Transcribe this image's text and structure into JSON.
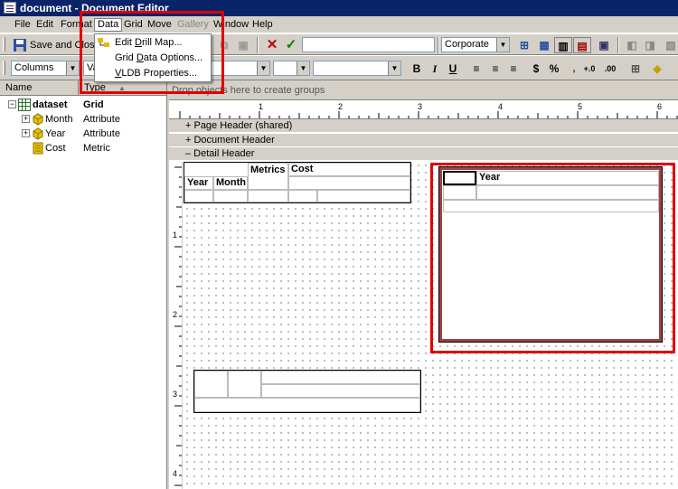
{
  "window": {
    "title": "document - Document Editor"
  },
  "menubar": {
    "file": "File",
    "edit": "Edit",
    "format": "Format",
    "data": "Data",
    "grid": "Grid",
    "move": "Move",
    "gallery": "Gallery",
    "window": "Window",
    "help": "Help"
  },
  "data_menu": {
    "items": [
      "Edit Drill Map...",
      "Grid Data Options...",
      "VLDB Properties..."
    ]
  },
  "toolbar1": {
    "save_close_label": "Save and Close",
    "style_select": "Corporate"
  },
  "toolbar2": {
    "columns_select": "Columns",
    "second_select": "Va"
  },
  "object_list": {
    "headers": {
      "name": "Name",
      "type": "Type"
    },
    "items": [
      {
        "name": "dataset",
        "type": "Grid"
      },
      {
        "name": "Month",
        "type": "Attribute"
      },
      {
        "name": "Year",
        "type": "Attribute"
      },
      {
        "name": "Cost",
        "type": "Metric"
      }
    ]
  },
  "editor": {
    "group_hint": "Drop objects here to create groups",
    "ruler_numbers": [
      "1",
      "2",
      "3",
      "4",
      "5",
      "6"
    ],
    "vruler_numbers": [
      "1",
      "2",
      "3",
      "4"
    ],
    "sections": [
      "+ Page Header (shared)",
      "+ Document Header",
      "– Detail Header"
    ]
  },
  "grid1": {
    "metrics": "Metrics",
    "cost": "Cost",
    "year": "Year",
    "month": "Month"
  },
  "grid2": {
    "year": "Year"
  },
  "colors": {
    "highlight": "#e00000",
    "titlebar": "#0a246a",
    "chrome": "#d4d0c8"
  }
}
